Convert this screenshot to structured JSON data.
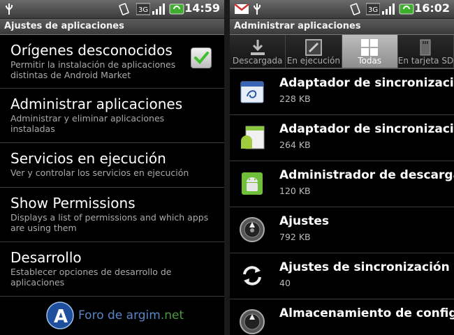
{
  "left": {
    "status_time": "14:59",
    "title": "Ajustes de aplicaciones",
    "settings": [
      {
        "title": "Orígenes desconocidos",
        "subtitle": "Permitir la instalación de aplicaciones distintas de Android Market",
        "checked": true
      },
      {
        "title": "Administrar aplicaciones",
        "subtitle": "Administrar y eliminar aplicaciones instaladas"
      },
      {
        "title": "Servicios en ejecución",
        "subtitle": "Ver y controlar los servicios en ejecución"
      },
      {
        "title": "Show Permissions",
        "subtitle": "Displays a list of permissions and which apps are using them"
      },
      {
        "title": "Desarrollo",
        "subtitle": "Establecer opciones de desarrollo de aplicaciones"
      }
    ],
    "watermark": {
      "text": "Foro de argim",
      "suffix": ".net",
      "logo_letter": "A"
    }
  },
  "right": {
    "status_time": "16:02",
    "title": "Administrar aplicaciones",
    "tabs": [
      {
        "label": "Descargada",
        "icon": "download-icon"
      },
      {
        "label": "En ejecución",
        "icon": "running-icon"
      },
      {
        "label": "Todas",
        "icon": "grid-icon",
        "selected": true
      },
      {
        "label": "En tarjeta SD",
        "icon": "sd-card-icon"
      }
    ],
    "apps": [
      {
        "name": "Adaptador de sincronización",
        "size": "228 KB",
        "icon": "calendar-sync-icon"
      },
      {
        "name": "Adaptador de sincronización",
        "size": "264 KB",
        "icon": "contacts-sync-icon"
      },
      {
        "name": "Administrador de descargas",
        "size": "120 KB",
        "icon": "android-icon"
      },
      {
        "name": "Ajustes",
        "size": "792 KB",
        "icon": "settings-icon"
      },
      {
        "name": "Ajustes de sincronización y",
        "size": "40",
        "icon": "sync-icon"
      },
      {
        "name": "Almacenamiento de configu",
        "size": "",
        "icon": "settings-storage-icon"
      }
    ]
  },
  "colors": {
    "accent_green": "#4ab73c",
    "title_bar": "#4a4a4a",
    "background": "#000000"
  }
}
